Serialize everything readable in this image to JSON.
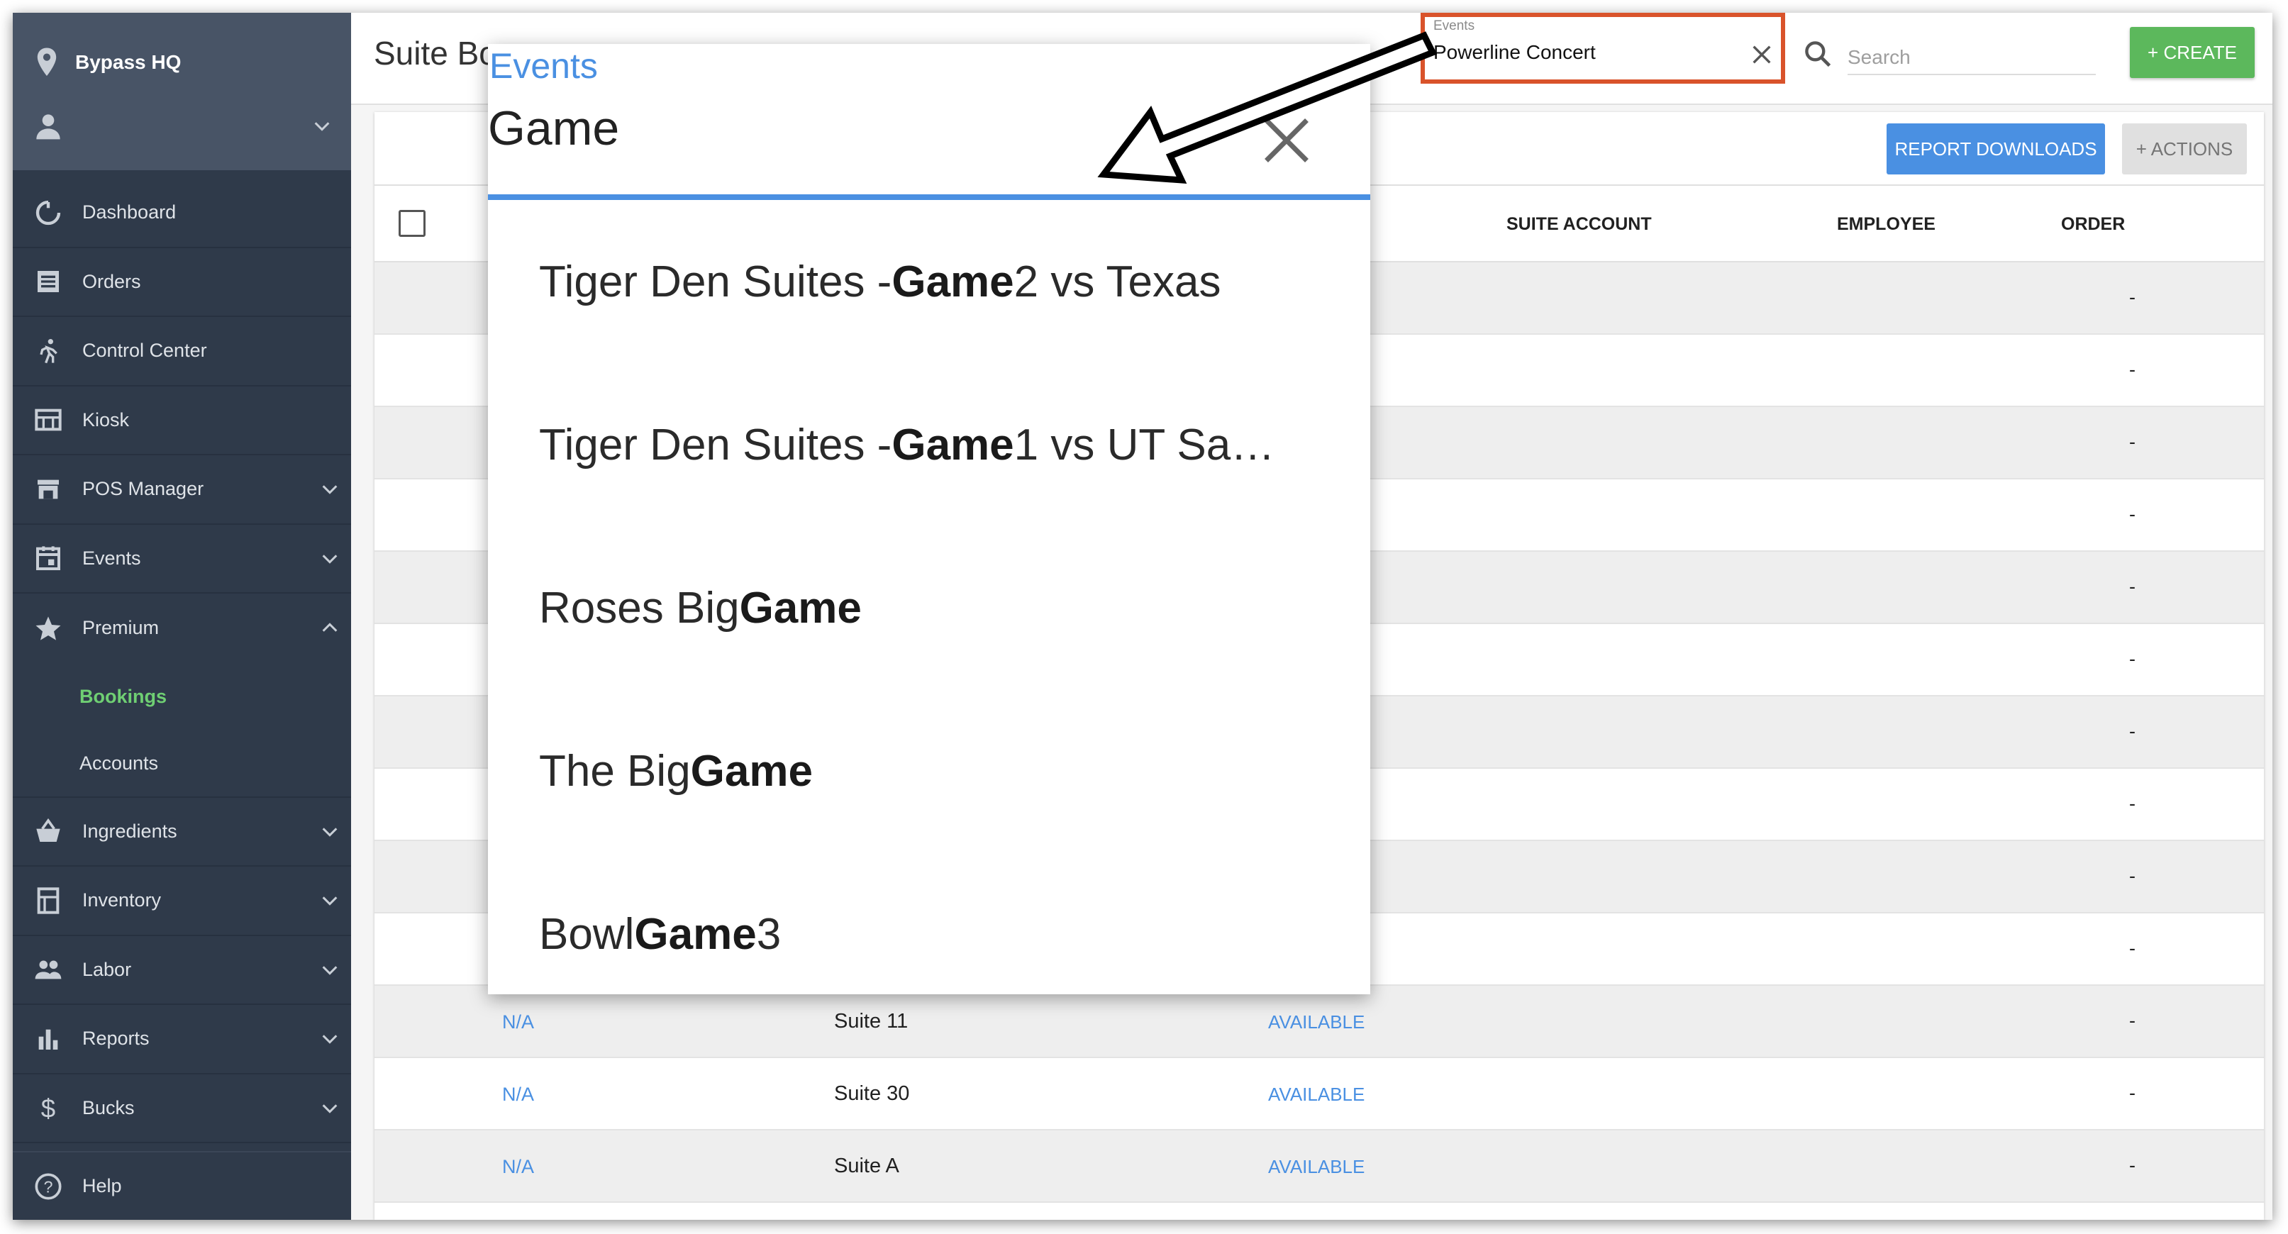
{
  "sidebar": {
    "venue": "Bypass HQ",
    "items": [
      {
        "label": "Dashboard",
        "icon": "dashboard-icon"
      },
      {
        "label": "Orders",
        "icon": "orders-icon"
      },
      {
        "label": "Control Center",
        "icon": "runner-icon"
      },
      {
        "label": "Kiosk",
        "icon": "kiosk-icon"
      },
      {
        "label": "POS Manager",
        "icon": "pos-icon"
      },
      {
        "label": "Events",
        "icon": "calendar-icon"
      },
      {
        "label": "Premium",
        "icon": "star-icon"
      },
      {
        "label": "Ingredients",
        "icon": "basket-icon"
      },
      {
        "label": "Inventory",
        "icon": "inventory-icon"
      },
      {
        "label": "Labor",
        "icon": "people-icon"
      },
      {
        "label": "Reports",
        "icon": "bar-chart-icon"
      },
      {
        "label": "Bucks",
        "icon": "dollar-icon"
      }
    ],
    "premium_sub": [
      "Bookings",
      "Accounts"
    ],
    "help": "Help"
  },
  "header": {
    "title": "Suite Bo",
    "events_filter": {
      "label": "Events",
      "value": "Powerline Concert"
    },
    "search_placeholder": "Search",
    "create_label": "+ CREATE"
  },
  "toolbar": {
    "report_label": "REPORT DOWNLOADS",
    "actions_label": "+ ACTIONS"
  },
  "table": {
    "columns": [
      "SUITE ACCOUNT",
      "EMPLOYEE",
      "ORDER"
    ],
    "rows": [
      {
        "c1": "",
        "c2": "",
        "c3": "",
        "order": "-"
      },
      {
        "c1": "",
        "c2": "",
        "c3": "",
        "order": "-"
      },
      {
        "c1": "",
        "c2": "",
        "c3": "",
        "order": "-"
      },
      {
        "c1": "",
        "c2": "",
        "c3": "",
        "order": "-"
      },
      {
        "c1": "",
        "c2": "",
        "c3": "",
        "order": "-"
      },
      {
        "c1": "",
        "c2": "",
        "c3": "",
        "order": "-"
      },
      {
        "c1": "",
        "c2": "",
        "c3": "",
        "order": "-"
      },
      {
        "c1": "",
        "c2": "",
        "c3": "",
        "order": "-"
      },
      {
        "c1": "",
        "c2": "",
        "c3": "",
        "order": "-"
      },
      {
        "c1": "",
        "c2": "",
        "c3": "",
        "order": "-"
      },
      {
        "c1": "N/A",
        "c2": "Suite 11",
        "c3": "AVAILABLE",
        "order": "-"
      },
      {
        "c1": "N/A",
        "c2": "Suite 30",
        "c3": "AVAILABLE",
        "order": "-"
      },
      {
        "c1": "N/A",
        "c2": "Suite A",
        "c3": "AVAILABLE",
        "order": "-"
      }
    ]
  },
  "dropdown": {
    "label": "Events",
    "query": "Game",
    "options": [
      {
        "pre": "Tiger Den Suites - ",
        "match": "Game",
        "post": " 2 vs Texas"
      },
      {
        "pre": "Tiger Den Suites - ",
        "match": "Game",
        "post": " 1 vs UT Sa…"
      },
      {
        "pre": "Roses Big ",
        "match": "Game",
        "post": ""
      },
      {
        "pre": "The Big ",
        "match": "Game",
        "post": ""
      },
      {
        "pre": "Bowl ",
        "match": "Game",
        "post": " 3"
      }
    ]
  },
  "colors": {
    "sidebar_bg": "#2f3a4a",
    "accent_blue": "#4a90e2",
    "create_green": "#5cb85c",
    "highlight_orange": "#d9532b",
    "active_green": "#6fcf73"
  }
}
